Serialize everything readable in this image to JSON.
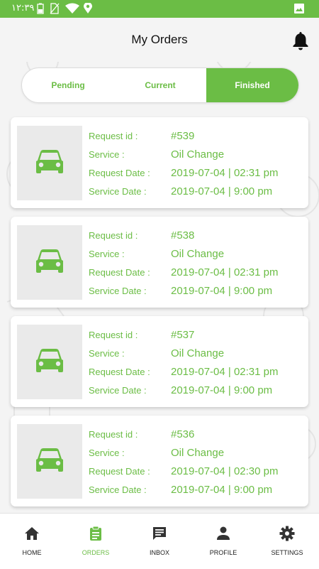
{
  "status_bar": {
    "time": "١٢:٣٩"
  },
  "header": {
    "title": "My Orders"
  },
  "tabs": [
    {
      "label": "Pending",
      "active": false
    },
    {
      "label": "Current",
      "active": false
    },
    {
      "label": "Finished",
      "active": true
    }
  ],
  "orders": [
    {
      "request_id_label": "Request id :",
      "request_id": "#539",
      "service_label": "Service :",
      "service": "Oil Change",
      "request_date_label": "Request Date :",
      "request_date": "2019-07-04 | 02:31 pm",
      "service_date_label": "Service Date :",
      "service_date": "2019-07-04 | 9:00 pm"
    },
    {
      "request_id_label": "Request id :",
      "request_id": "#538",
      "service_label": "Service :",
      "service": "Oil Change",
      "request_date_label": "Request Date :",
      "request_date": "2019-07-04 | 02:31 pm",
      "service_date_label": "Service Date :",
      "service_date": "2019-07-04 | 9:00 pm"
    },
    {
      "request_id_label": "Request id :",
      "request_id": "#537",
      "service_label": "Service :",
      "service": "Oil Change",
      "request_date_label": "Request Date :",
      "request_date": "2019-07-04 | 02:31 pm",
      "service_date_label": "Service Date :",
      "service_date": "2019-07-04 | 9:00 pm"
    },
    {
      "request_id_label": "Request id :",
      "request_id": "#536",
      "service_label": "Service :",
      "service": "Oil Change",
      "request_date_label": "Request Date :",
      "request_date": "2019-07-04 | 02:30 pm",
      "service_date_label": "Service Date :",
      "service_date": "2019-07-04 | 9:00 pm"
    }
  ],
  "bottom_nav": [
    {
      "label": "HOME",
      "icon": "home-icon",
      "active": false
    },
    {
      "label": "ORDERS",
      "icon": "clipboard-icon",
      "active": true
    },
    {
      "label": "INBOX",
      "icon": "chat-icon",
      "active": false
    },
    {
      "label": "PROFILE",
      "icon": "person-icon",
      "active": false
    },
    {
      "label": "SETTINGS",
      "icon": "gear-icon",
      "active": false
    }
  ],
  "colors": {
    "accent": "#6bbd45",
    "background": "#f4f4f4",
    "card": "#ffffff"
  }
}
